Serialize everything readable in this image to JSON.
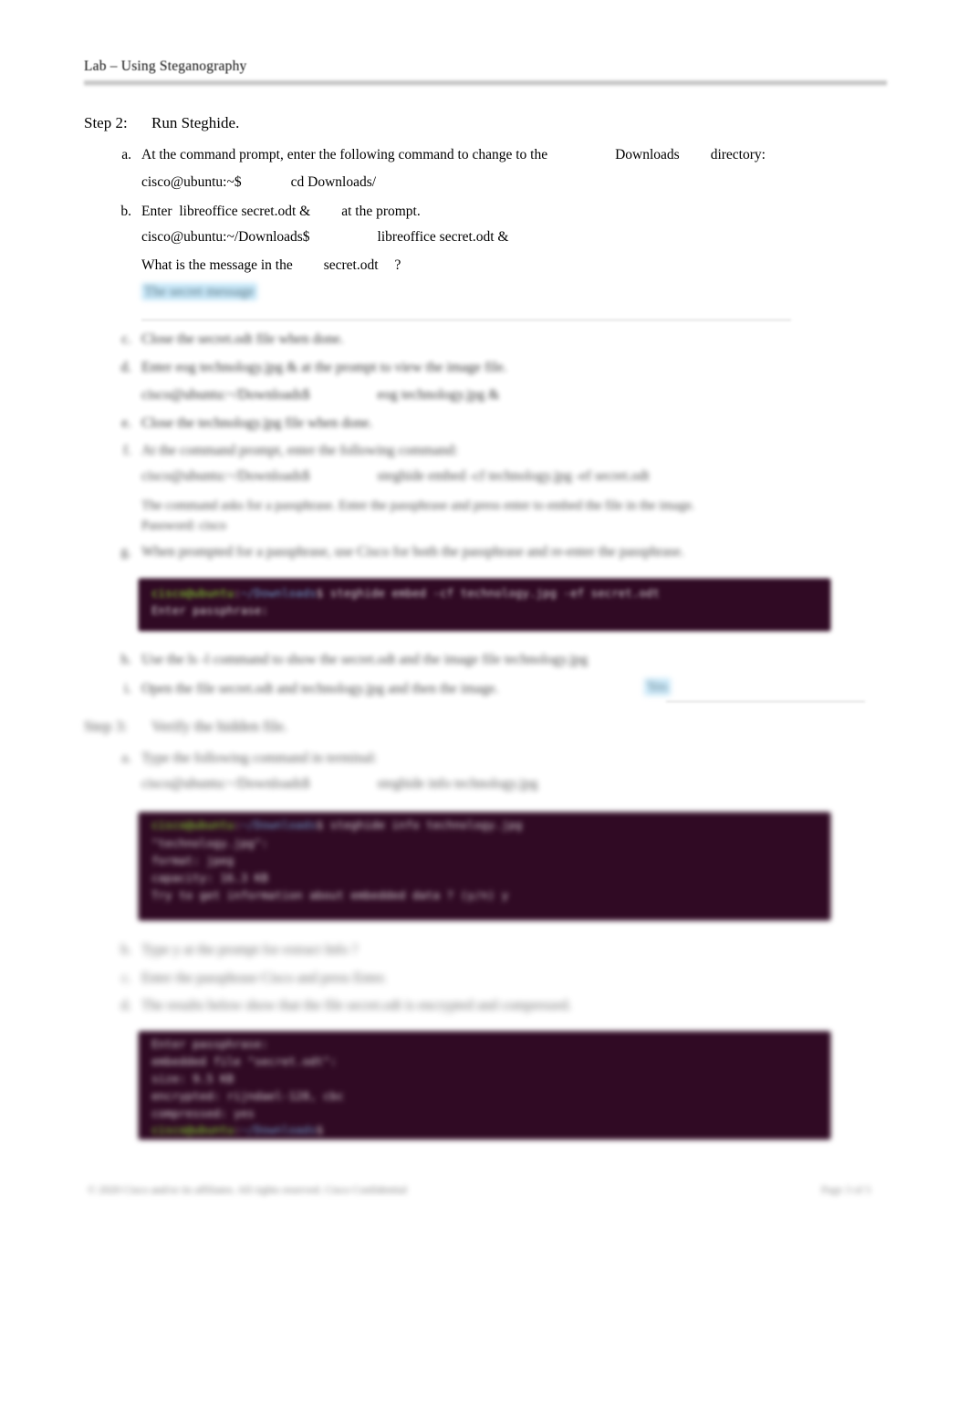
{
  "header": {
    "title": "Lab – Using Steganography"
  },
  "step2": {
    "number": "Step 2:",
    "title": "Run Steghide.",
    "items": [
      {
        "marker": "a.",
        "text_a": "At the command prompt, enter the following command to change to the",
        "text_b": "Downloads",
        "text_c": "directory:",
        "prompt": "cisco@ubuntu:~$",
        "command": "cd Downloads/"
      },
      {
        "marker": "b.",
        "text_a": "Enter",
        "text_b": "libreoffice secret.odt &",
        "text_c": "at the prompt.",
        "prompt": "cisco@ubuntu:~/Downloads$",
        "command": "libreoffice secret.odt &",
        "question_a": "What is the message in the",
        "question_b": "secret.odt",
        "question_c": "?",
        "answer": "The secret message"
      },
      {
        "marker": "c.",
        "text": "Close the      secret.odt      file when done."
      },
      {
        "marker": "d.",
        "text": "Enter      eog technology.jpg &      at the prompt to view the image file.",
        "prompt": "cisco@ubuntu:~/Downloads$",
        "command": "eog technology.jpg &"
      },
      {
        "marker": "e.",
        "text": "Close the      technology.jpg      file when done."
      },
      {
        "marker": "f.",
        "text": "At the command prompt, enter the following command:",
        "prompt": "cisco@ubuntu:~/Downloads$",
        "command": "steghide embed -cf technology.jpg -ef secret.odt",
        "note_a": "The command asks for a passphrase. Enter the passphrase and press enter to embed the file in the image.",
        "note_b": "Password:      cisco"
      },
      {
        "marker": "g.",
        "text": "When prompted for a passphrase, use      Cisco      for both the passphrase and re-enter the passphrase."
      },
      {
        "marker": "h.",
        "text": "Use the      ls -l      command to show the     secret.odt     and the image file     technology.jpg"
      },
      {
        "marker": "i.",
        "text": "Open the file      secret.odt      and      technology.jpg      and then the image.",
        "answer": "Yes"
      }
    ]
  },
  "step3": {
    "number": "Step 3:",
    "title": "Verify the hidden file.",
    "items": [
      {
        "marker": "a.",
        "text": "Type the following command in terminal:",
        "prompt": "cisco@ubuntu:~/Downloads$",
        "command": "steghide info technology.jpg"
      },
      {
        "marker": "b.",
        "text": "Type      y      at the prompt for extract      Info ?"
      },
      {
        "marker": "c.",
        "text": "Enter the passphrase      Cisco      and press      Enter."
      },
      {
        "marker": "d.",
        "text": "The results below show that the file secret.odt is encrypted and compressed."
      }
    ]
  },
  "terminals": [
    {
      "id": "terminal-1",
      "lines": [
        {
          "prompt": "cisco@ubuntu",
          "sep": ":",
          "path": "~/Downloads",
          "sym": "$",
          "cmd": " steghide embed -cf technology.jpg -ef secret.odt"
        },
        {
          "cmd_only": "Enter passphrase:"
        }
      ]
    },
    {
      "id": "terminal-2",
      "lines": [
        {
          "prompt": "cisco@ubuntu",
          "sep": ":",
          "path": "~/Downloads",
          "sym": "$",
          "cmd": " steghide info technology.jpg"
        },
        {
          "cmd_only": "\"technology.jpg\":"
        },
        {
          "cmd_only": "  format: jpeg"
        },
        {
          "cmd_only": "  capacity: 16.3 KB"
        },
        {
          "cmd_only": "Try to get information about embedded data ? (y/n) y"
        }
      ]
    },
    {
      "id": "terminal-3",
      "lines": [
        {
          "cmd_only": "Enter passphrase:"
        },
        {
          "cmd_only": "  embedded file \"secret.odt\":"
        },
        {
          "cmd_only": "    size: 9.5 KB"
        },
        {
          "cmd_only": "    encrypted: rijndael-128, cbc"
        },
        {
          "cmd_only": "    compressed: yes"
        },
        {
          "prompt": "cisco@ubuntu",
          "sep": ":",
          "path": "~/Downloads",
          "sym": "$",
          "cmd": ""
        }
      ]
    }
  ],
  "footer": {
    "copyright": "© 2020 Cisco and/or its affiliates. All rights reserved. Cisco Confidential",
    "page": "Page 3 of 5"
  },
  "colors": {
    "terminal_bg": "#300a24",
    "terminal_green": "#8ae234",
    "terminal_blue": "#729fcf",
    "terminal_text": "#d8d2d6",
    "highlight": "#bfe4f8",
    "rule": "#c9c9c9"
  }
}
